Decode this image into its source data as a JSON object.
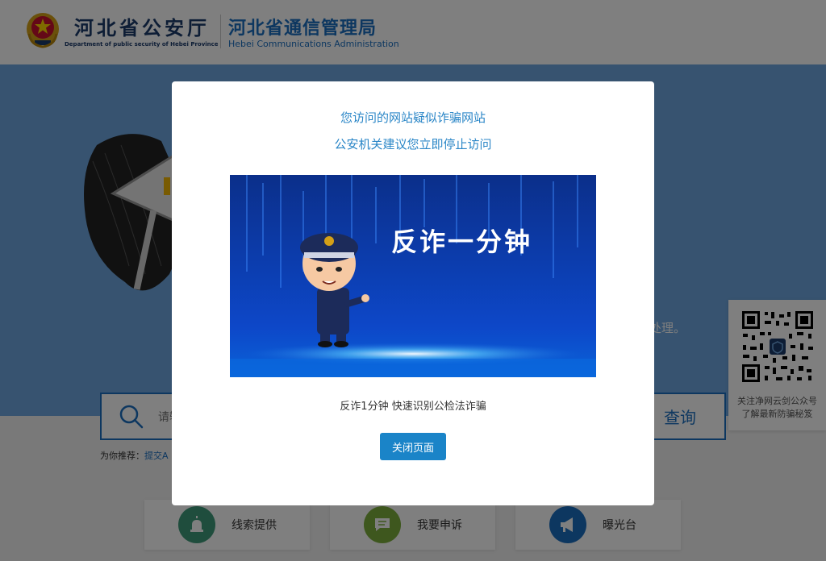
{
  "header": {
    "org1_title": "河北省公安厅",
    "org1_subtitle": "Department of public security of Hebei Province",
    "org2_title": "河北省通信管理局",
    "org2_subtitle": "Hebei Communications Administration"
  },
  "banner": {
    "visible_text_tail": "时处理。"
  },
  "search": {
    "placeholder": "请输",
    "button_label": "查询"
  },
  "recommend": {
    "label": "为你推荐：",
    "link": "提交A"
  },
  "quick_links": [
    {
      "label": "线索提供",
      "icon": "siren-icon",
      "color": "#3f9b7a"
    },
    {
      "label": "我要申诉",
      "icon": "chat-icon",
      "color": "#7cae3c"
    },
    {
      "label": "曝光台",
      "icon": "megaphone-icon",
      "color": "#1a6fc1"
    }
  ],
  "qr_panel": {
    "caption_line1": "关注净网云剑公众号",
    "caption_line2": "了解最新防骗秘笈"
  },
  "modal": {
    "warning_line1": "您访问的网站疑似诈骗网站",
    "warning_line2": "公安机关建议您立即停止访问",
    "video_title": "反诈一分钟",
    "video_caption": "反诈1分钟 快速识别公检法诈骗",
    "close_button": "关闭页面"
  },
  "colors": {
    "accent": "#1a84c8",
    "header_text": "#1b3a6b",
    "banner_bg": "#6ea7e0",
    "overlay": "rgba(0,0,0,0.5)"
  }
}
